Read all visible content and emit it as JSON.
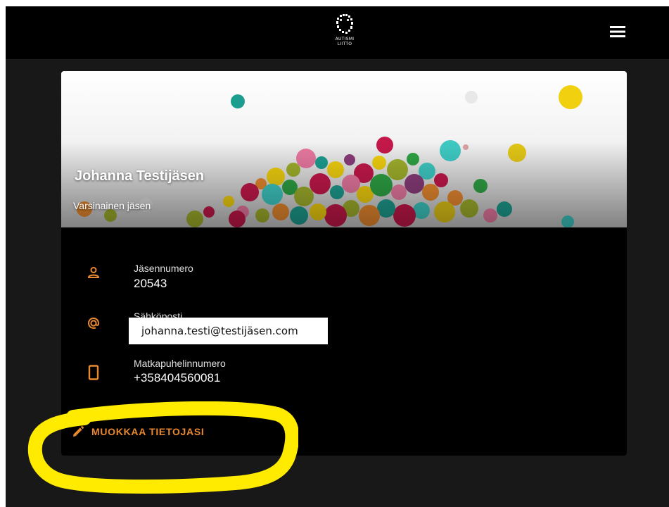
{
  "header": {
    "logo_line1": "AUTISMI",
    "logo_line2": "LIITTO",
    "menu_icon": "hamburger-menu-icon"
  },
  "profile": {
    "name": "Johanna Testijäsen",
    "membership_type": "Varsinainen jäsen"
  },
  "fields": {
    "member_number": {
      "label": "Jäsennumero",
      "value": "20543",
      "icon": "person-icon"
    },
    "email": {
      "label": "Sähköposti",
      "value": "johanna.testi@testijäsen.com",
      "icon": "at-sign-icon"
    },
    "phone": {
      "label": "Matkapuhelinnumero",
      "value": "+358404560081",
      "icon": "mobile-phone-icon"
    }
  },
  "actions": {
    "edit_label": "MUOKKAA TIETOJASI",
    "edit_icon": "pencil-icon"
  },
  "colors": {
    "accent": "#e8892f",
    "highlight": "#ffeb00",
    "background": "#181818",
    "card": "#000000"
  }
}
